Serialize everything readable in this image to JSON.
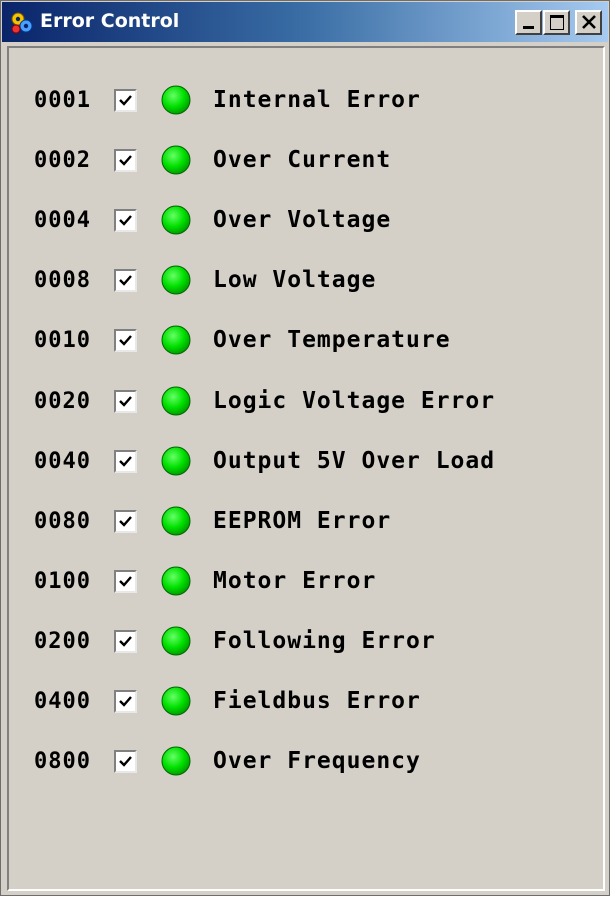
{
  "window": {
    "title": "Error Control",
    "title_icon": "gears-icon",
    "buttons": [
      "minimize",
      "maximize",
      "close"
    ]
  },
  "colors": {
    "titlebar_start": "#0a246a",
    "titlebar_end": "#a6caf0",
    "led_on": "#00e000",
    "background": "#d4d0c8"
  },
  "errors": [
    {
      "code": "0001",
      "checked": true,
      "status": "ok",
      "label": "Internal Error"
    },
    {
      "code": "0002",
      "checked": true,
      "status": "ok",
      "label": "Over Current"
    },
    {
      "code": "0004",
      "checked": true,
      "status": "ok",
      "label": "Over Voltage"
    },
    {
      "code": "0008",
      "checked": true,
      "status": "ok",
      "label": "Low Voltage"
    },
    {
      "code": "0010",
      "checked": true,
      "status": "ok",
      "label": "Over Temperature"
    },
    {
      "code": "0020",
      "checked": true,
      "status": "ok",
      "label": "Logic Voltage Error"
    },
    {
      "code": "0040",
      "checked": true,
      "status": "ok",
      "label": "Output 5V Over Load"
    },
    {
      "code": "0080",
      "checked": true,
      "status": "ok",
      "label": "EEPROM Error"
    },
    {
      "code": "0100",
      "checked": true,
      "status": "ok",
      "label": "Motor Error"
    },
    {
      "code": "0200",
      "checked": true,
      "status": "ok",
      "label": "Following Error"
    },
    {
      "code": "0400",
      "checked": true,
      "status": "ok",
      "label": "Fieldbus Error"
    },
    {
      "code": "0800",
      "checked": true,
      "status": "ok",
      "label": "Over Frequency"
    }
  ]
}
